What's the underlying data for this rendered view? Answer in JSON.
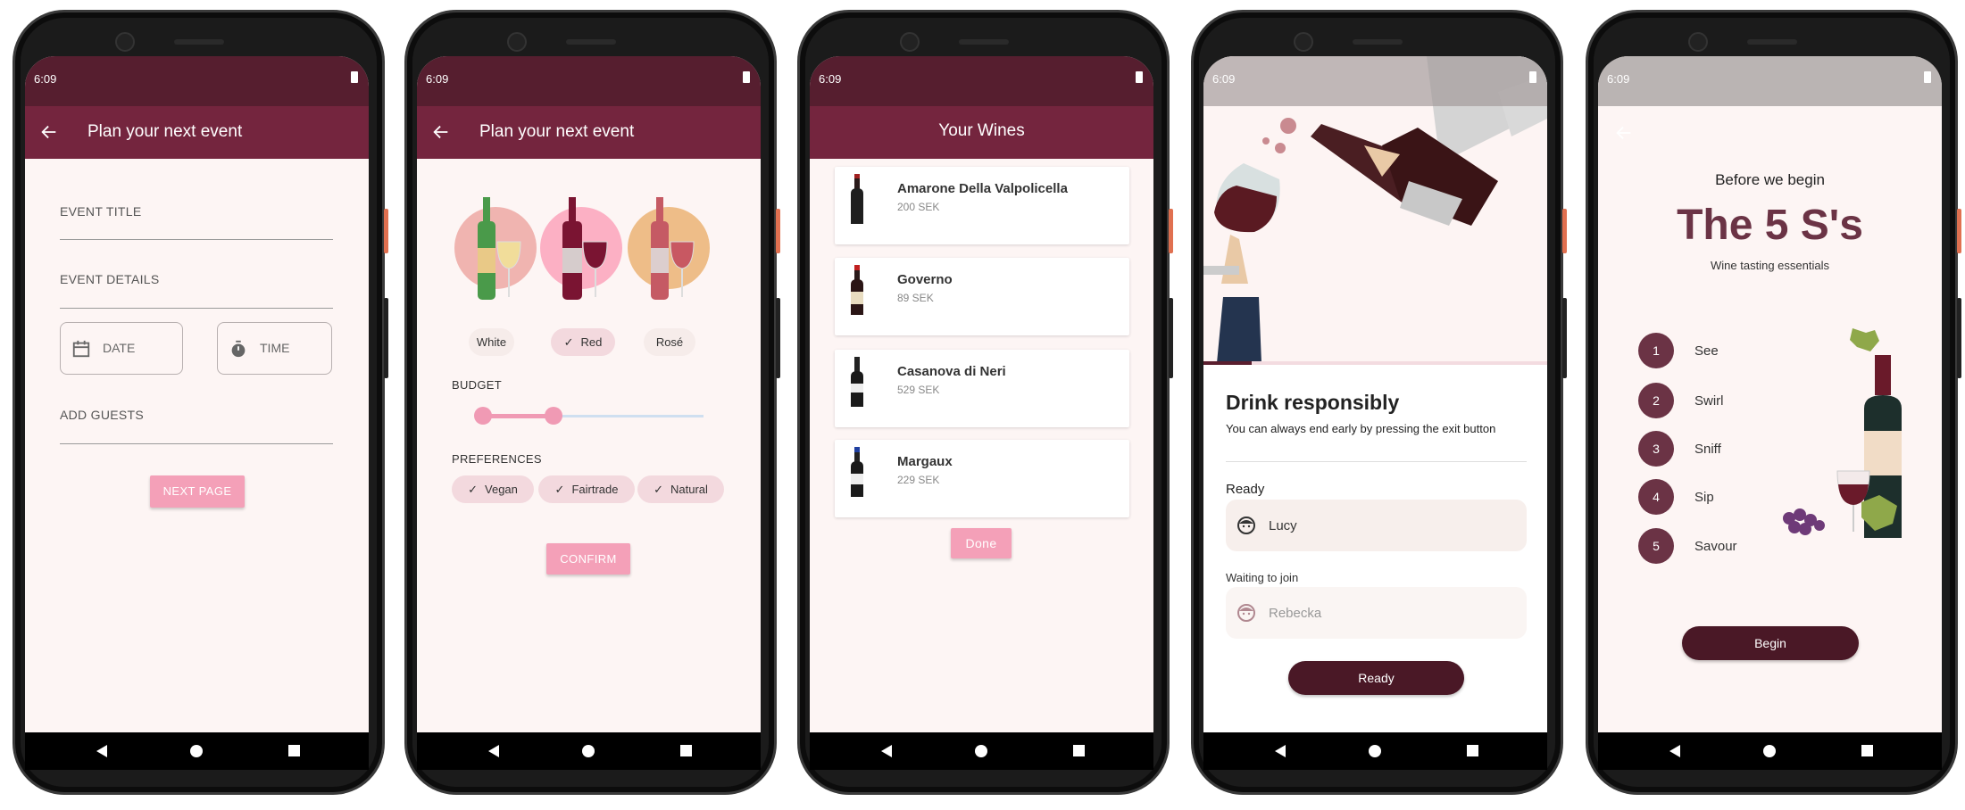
{
  "status_time": "6:09",
  "colors": {
    "status_bar": "#561e2f",
    "app_bar": "#74253e",
    "background": "#fdf5f4",
    "accent_pink": "#f4a0b8",
    "dark_button": "#4a1826",
    "step_circle": "#6b3345"
  },
  "screen1": {
    "title": "Plan your next event",
    "event_title_label": "EVENT TITLE",
    "event_details_label": "EVENT DETAILS",
    "date_label": "DATE",
    "time_label": "TIME",
    "add_guests_label": "ADD GUESTS",
    "next_button": "NEXT PAGE"
  },
  "screen2": {
    "title": "Plan your next event",
    "wine_types": [
      {
        "label": "White",
        "selected": false
      },
      {
        "label": "Red",
        "selected": true
      },
      {
        "label": "Rosé",
        "selected": false
      }
    ],
    "budget_label": "BUDGET",
    "budget_range_fraction": [
      0.03,
      0.34
    ],
    "preferences_label": "PREFERENCES",
    "preferences": [
      {
        "label": "Vegan",
        "selected": true
      },
      {
        "label": "Fairtrade",
        "selected": true
      },
      {
        "label": "Natural",
        "selected": true
      }
    ],
    "confirm_button": "CONFIRM"
  },
  "screen3": {
    "title": "Your Wines",
    "wines": [
      {
        "name": "Amarone Della Valpolicella",
        "price": "200 SEK"
      },
      {
        "name": "Governo",
        "price": "89 SEK"
      },
      {
        "name": "Casanova di Neri",
        "price": "529 SEK"
      },
      {
        "name": "Margaux",
        "price": "229 SEK"
      }
    ],
    "done_button": "Done"
  },
  "screen4": {
    "heading": "Drink responsibly",
    "subtitle": "You can always end early by pressing the exit button",
    "ready_label": "Ready",
    "ready_participants": [
      "Lucy"
    ],
    "waiting_label": "Waiting to join",
    "waiting_participants": [
      "Rebecka"
    ],
    "ready_button": "Ready",
    "progress_fraction": 0.14
  },
  "screen5": {
    "pre_title": "Before we begin",
    "title": "The 5 S's",
    "subtitle": "Wine tasting essentials",
    "steps": [
      {
        "num": "1",
        "label": "See"
      },
      {
        "num": "2",
        "label": "Swirl"
      },
      {
        "num": "3",
        "label": "Sniff"
      },
      {
        "num": "4",
        "label": "Sip"
      },
      {
        "num": "5",
        "label": "Savour"
      }
    ],
    "begin_button": "Begin"
  }
}
